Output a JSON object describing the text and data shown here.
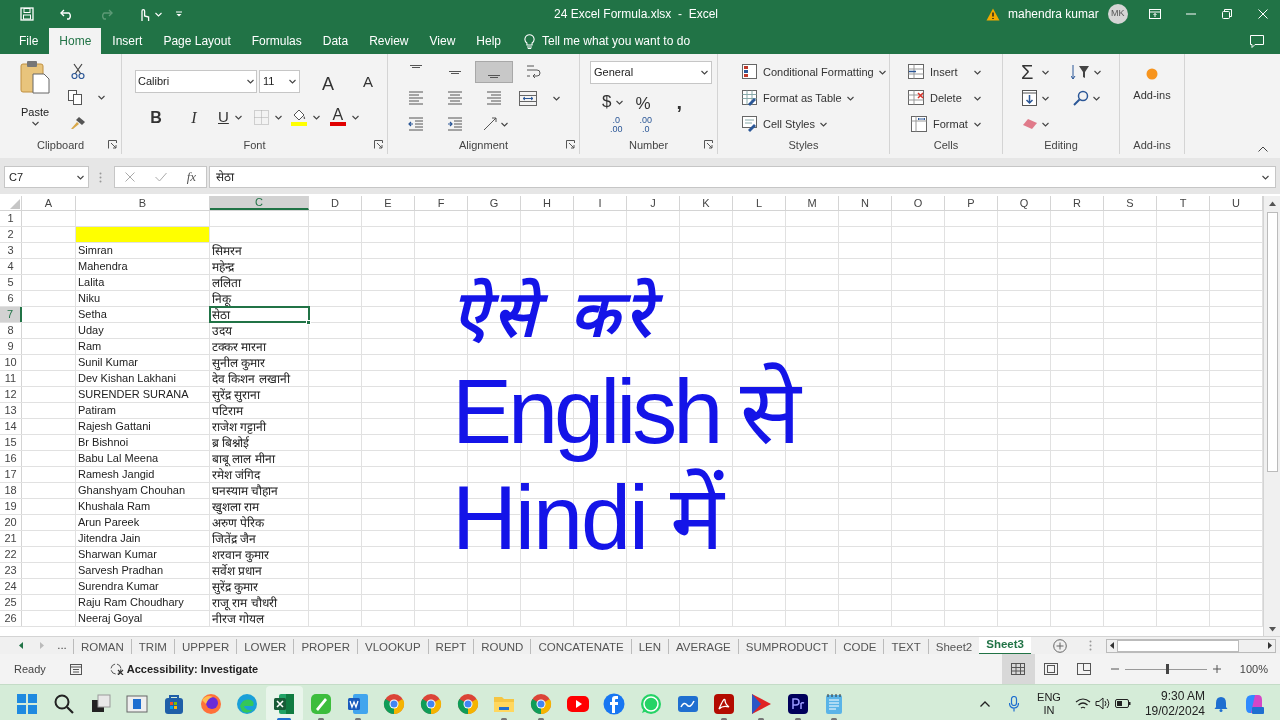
{
  "window": {
    "title": "24 Excel Formula.xlsx  -  Excel",
    "user": "mahendra kumar",
    "user_initials": "MK"
  },
  "ribbon_tabs": [
    {
      "label": "File",
      "selected": false
    },
    {
      "label": "Home",
      "selected": true
    },
    {
      "label": "Insert",
      "selected": false
    },
    {
      "label": "Page Layout",
      "selected": false
    },
    {
      "label": "Formulas",
      "selected": false
    },
    {
      "label": "Data",
      "selected": false
    },
    {
      "label": "Review",
      "selected": false
    },
    {
      "label": "View",
      "selected": false
    },
    {
      "label": "Help",
      "selected": false
    }
  ],
  "tell_me": "Tell me what you want to do",
  "ribbon_groups": [
    {
      "kind": "clipboard",
      "label": "Clipboard",
      "paste": "Paste"
    },
    {
      "kind": "font",
      "label": "Font",
      "font_name": "Calibri",
      "font_size": "11",
      "size_buttons": [
        "A",
        "A"
      ],
      "format_buttons": [
        "B",
        "I",
        "U"
      ],
      "font_color_glyph": "A"
    },
    {
      "kind": "alignment",
      "label": "Alignment",
      "vertical_align_buttons": [
        {
          "selected": false
        },
        {
          "selected": false
        },
        {
          "selected": true
        }
      ]
    },
    {
      "kind": "number",
      "label": "Number",
      "format": "General",
      "currency": "$",
      "percent": "%",
      "comma": ",",
      "decimals": [
        [
          ".0",
          ".00"
        ],
        [
          ".00",
          ".0"
        ]
      ]
    },
    {
      "kind": "styles",
      "label": "Styles",
      "buttons": [
        "Conditional Formatting",
        "Format as Table",
        "Cell Styles"
      ]
    },
    {
      "kind": "cells",
      "label": "Cells",
      "buttons": [
        "Insert",
        "Delete",
        "Format"
      ]
    },
    {
      "kind": "editing",
      "label": "Editing",
      "sum": "Σ"
    },
    {
      "kind": "addins",
      "label": "Add-ins",
      "button": "Add-ins"
    }
  ],
  "formula_bar": {
    "name_box": "C7",
    "function_label": "fx",
    "value": "सेठा"
  },
  "columns": [
    {
      "label": "A",
      "selected": false
    },
    {
      "label": "B",
      "selected": false
    },
    {
      "label": "C",
      "selected": true
    },
    {
      "label": "D",
      "selected": false
    },
    {
      "label": "E",
      "selected": false
    },
    {
      "label": "F",
      "selected": false
    },
    {
      "label": "G",
      "selected": false
    },
    {
      "label": "H",
      "selected": false
    },
    {
      "label": "I",
      "selected": false
    },
    {
      "label": "J",
      "selected": false
    },
    {
      "label": "K",
      "selected": false
    },
    {
      "label": "L",
      "selected": false
    },
    {
      "label": "M",
      "selected": false
    },
    {
      "label": "N",
      "selected": false
    },
    {
      "label": "O",
      "selected": false
    },
    {
      "label": "P",
      "selected": false
    },
    {
      "label": "Q",
      "selected": false
    },
    {
      "label": "R",
      "selected": false
    },
    {
      "label": "S",
      "selected": false
    },
    {
      "label": "T",
      "selected": false
    },
    {
      "label": "U",
      "selected": false
    }
  ],
  "rows": [
    {
      "number": "1",
      "selected": false
    },
    {
      "number": "2",
      "selected": false,
      "b_highlighted": true
    },
    {
      "number": "3",
      "selected": false,
      "b": "Simran",
      "c": "सिमरन"
    },
    {
      "number": "4",
      "selected": false,
      "b": "Mahendra",
      "c": "महेन्द्र"
    },
    {
      "number": "5",
      "selected": false,
      "b": "Lalita",
      "c": "ललिता"
    },
    {
      "number": "6",
      "selected": false,
      "b": "Niku",
      "c": "निकू"
    },
    {
      "number": "7",
      "selected": true,
      "b": "Setha",
      "c": "सेठा"
    },
    {
      "number": "8",
      "selected": false,
      "b": "Uday",
      "c": "उदय"
    },
    {
      "number": "9",
      "selected": false,
      "b": "Ram",
      "c": "टक्कर मारना"
    },
    {
      "number": "10",
      "selected": false,
      "b": "Sunil Kumar",
      "c": "सुनील कुमार"
    },
    {
      "number": "11",
      "selected": false,
      "b": "Dev Kishan Lakhani",
      "c": "देव किशन लखानी"
    },
    {
      "number": "12",
      "selected": false,
      "b": "SURENDER SURANA",
      "c": "सुरेंद्र सुराना"
    },
    {
      "number": "13",
      "selected": false,
      "b": "Patiram",
      "c": "पटिराम"
    },
    {
      "number": "14",
      "selected": false,
      "b": "Rajesh Gattani",
      "c": "राजेश गट्टानी"
    },
    {
      "number": "15",
      "selected": false,
      "b": "Br Bishnoi",
      "c": "ब्र बिश्नोई"
    },
    {
      "number": "16",
      "selected": false,
      "b": "Babu Lal Meena",
      "c": "बाबू लाल मीना"
    },
    {
      "number": "17",
      "selected": false,
      "b": "Ramesh Jangid",
      "c": "रमेश जंगिद"
    },
    {
      "number": "18",
      "selected": false,
      "b": "Ghanshyam Chouhan",
      "c": "घनस्याम चौहान"
    },
    {
      "number": "19",
      "selected": false,
      "b": "Khushala Ram",
      "c": "खुशला राम"
    },
    {
      "number": "20",
      "selected": false,
      "b": "Arun Pareek",
      "c": "अरुण पेरिक"
    },
    {
      "number": "21",
      "selected": false,
      "b": "Jitendra Jain",
      "c": "जितेंद्र जैन"
    },
    {
      "number": "22",
      "selected": false,
      "b": "Sharwan Kumar",
      "c": "शरवान कुमार"
    },
    {
      "number": "23",
      "selected": false,
      "b": "Sarvesh Pradhan",
      "c": "सर्वेश प्रधान"
    },
    {
      "number": "24",
      "selected": false,
      "b": "Surendra Kumar",
      "c": "सुरेंद्र कुमार"
    },
    {
      "number": "25",
      "selected": false,
      "b": "Raju Ram Choudhary",
      "c": "राजू राम चौधरी"
    },
    {
      "number": "26",
      "selected": false,
      "b": "Neeraj Goyal",
      "c": "नीरज गोयल"
    }
  ],
  "overlay_text": [
    "ऐसे करे",
    "English से",
    "Hindi में"
  ],
  "sheet_tabs": {
    "more": "...",
    "tabs": [
      {
        "label": "ROMAN",
        "selected": false
      },
      {
        "label": "TRIM",
        "selected": false
      },
      {
        "label": "UPPPER",
        "selected": false
      },
      {
        "label": "LOWER",
        "selected": false
      },
      {
        "label": "PROPER",
        "selected": false
      },
      {
        "label": "VLOOKUP",
        "selected": false
      },
      {
        "label": "REPT",
        "selected": false
      },
      {
        "label": "ROUND",
        "selected": false
      },
      {
        "label": "CONCATENATE",
        "selected": false
      },
      {
        "label": "LEN",
        "selected": false
      },
      {
        "label": "AVERAGE",
        "selected": false
      },
      {
        "label": "SUMPRODUCT",
        "selected": false
      },
      {
        "label": "CODE",
        "selected": false
      },
      {
        "label": "TEXT",
        "selected": false
      },
      {
        "label": "Sheet2",
        "selected": false
      },
      {
        "label": "Sheet3",
        "selected": true
      }
    ]
  },
  "status_bar": {
    "ready": "Ready",
    "accessibility": "Accessibility: Investigate",
    "views": [
      {
        "kind": "normal",
        "selected": true
      },
      {
        "kind": "page-layout",
        "selected": false
      },
      {
        "kind": "page-break",
        "selected": false
      }
    ],
    "zoom": {
      "level": 0.52,
      "reading": "100%"
    }
  },
  "taskbar": {
    "apps": [
      {
        "kind": "start",
        "running": false
      },
      {
        "kind": "search",
        "running": false
      },
      {
        "kind": "task-view",
        "running": false
      },
      {
        "kind": "window",
        "running": false
      },
      {
        "kind": "store",
        "running": false
      },
      {
        "kind": "firefox",
        "running": false
      },
      {
        "kind": "edge",
        "running": false
      },
      {
        "kind": "excel",
        "running": true
      },
      {
        "kind": "pen",
        "running": true
      },
      {
        "kind": "word",
        "running": true
      },
      {
        "kind": "chrome",
        "running": false
      },
      {
        "kind": "chrome",
        "running": false
      },
      {
        "kind": "chrome",
        "running": false
      },
      {
        "kind": "folder",
        "running": true
      },
      {
        "kind": "chrome",
        "running": true
      },
      {
        "kind": "youtube",
        "running": false
      },
      {
        "kind": "facebook",
        "running": false
      },
      {
        "kind": "whatsapp",
        "running": false
      },
      {
        "kind": "whiteboard",
        "running": false
      },
      {
        "kind": "acrobat",
        "running": true
      },
      {
        "kind": "play",
        "running": true
      },
      {
        "kind": "premiere",
        "running": true
      },
      {
        "kind": "notepad",
        "running": true
      }
    ],
    "language": [
      "ENG",
      "IN"
    ],
    "time": "9:30 AM",
    "date": "19/02/2024"
  }
}
